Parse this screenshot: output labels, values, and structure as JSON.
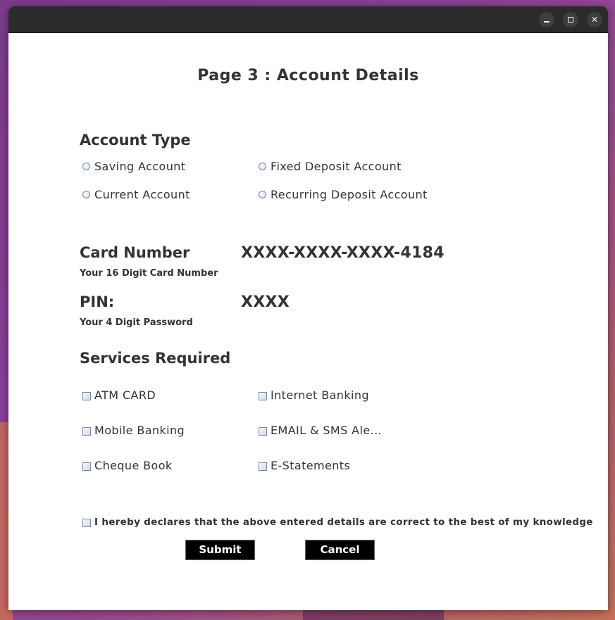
{
  "window": {
    "controls": {
      "minimize_icon": "minimize-icon",
      "maximize_icon": "maximize-icon",
      "close_icon": "close-icon",
      "close_glyph": "✕"
    }
  },
  "page": {
    "title": "Page 3 : Account Details"
  },
  "account_type": {
    "heading": "Account Type",
    "options": [
      "Saving Account",
      "Fixed Deposit Account",
      "Current Account",
      "Recurring Deposit Account"
    ],
    "selected": null
  },
  "card": {
    "heading": "Card Number",
    "hint": "Your 16 Digit Card Number",
    "value": "XXXX-XXXX-XXXX-4184"
  },
  "pin": {
    "heading": "PIN:",
    "hint": "Your 4 Digit Password",
    "value": "XXXX"
  },
  "services": {
    "heading": "Services Required",
    "options": [
      "ATM CARD",
      "Internet Banking",
      "Mobile Banking",
      "EMAIL & SMS Ale...",
      "Cheque Book",
      "E-Statements"
    ],
    "checked": [
      false,
      false,
      false,
      false,
      false,
      false
    ]
  },
  "declaration": {
    "text": "I hereby declares that the above entered details are correct to the best of my knowledge",
    "checked": false
  },
  "buttons": {
    "submit": "Submit",
    "cancel": "Cancel"
  }
}
